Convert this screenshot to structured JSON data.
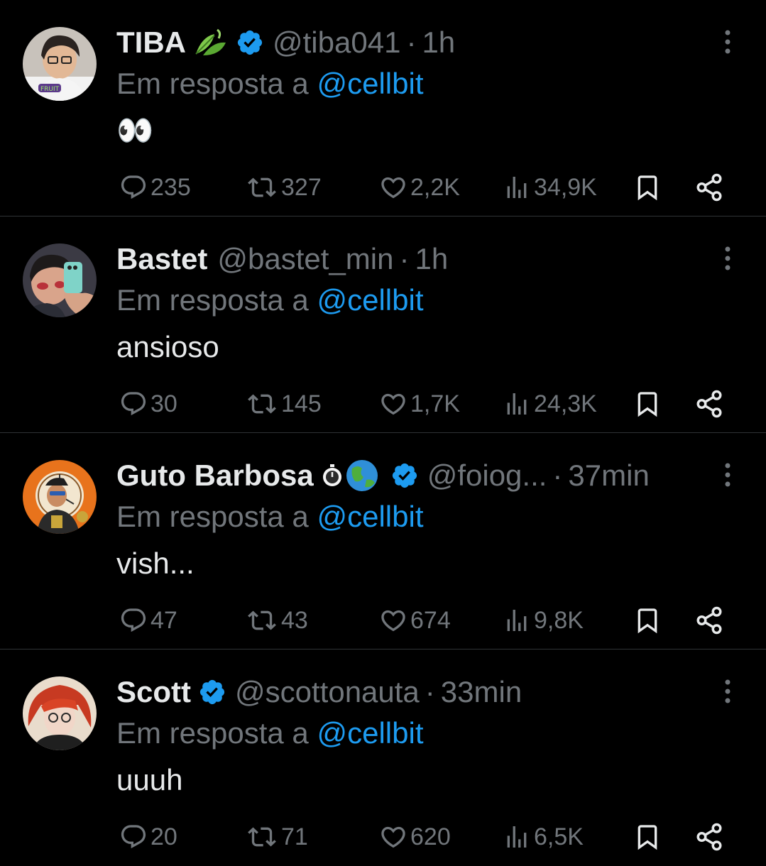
{
  "colors": {
    "background": "#000000",
    "primary_text": "#e7e9ea",
    "secondary_text": "#71767b",
    "accent": "#1d9bf0",
    "divider": "#2f3336"
  },
  "tweets": [
    {
      "name": "TIBA",
      "name_emoji": "herb-leaves-emoji",
      "verified": true,
      "handle": "@tiba041",
      "dot": "·",
      "time": "1h",
      "reply_prefix": "Em resposta a ",
      "reply_to": "@cellbit",
      "text": "👀",
      "replies": "235",
      "retweets": "327",
      "likes": "2,2K",
      "views": "34,9K"
    },
    {
      "name": "Bastet",
      "verified": false,
      "handle": "@bastet_min",
      "dot": "·",
      "time": "1h",
      "reply_prefix": "Em resposta a ",
      "reply_to": "@cellbit",
      "text": "ansioso",
      "replies": "30",
      "retweets": "145",
      "likes": "1,7K",
      "views": "24,3K"
    },
    {
      "name": "Guto Barbosa",
      "name_emoji": "timer-globe-emoji",
      "verified": true,
      "handle": "@foiog...",
      "dot": " ·",
      "time": "37min",
      "reply_prefix": "Em resposta a ",
      "reply_to": "@cellbit",
      "text": "vish...",
      "replies": "47",
      "retweets": "43",
      "likes": "674",
      "views": "9,8K"
    },
    {
      "name": "Scott",
      "verified": true,
      "handle": "@scottonauta",
      "dot": "·",
      "time": "33min",
      "reply_prefix": "Em resposta a ",
      "reply_to": "@cellbit",
      "text": "uuuh",
      "replies": "20",
      "retweets": "71",
      "likes": "620",
      "views": "6,5K"
    }
  ]
}
